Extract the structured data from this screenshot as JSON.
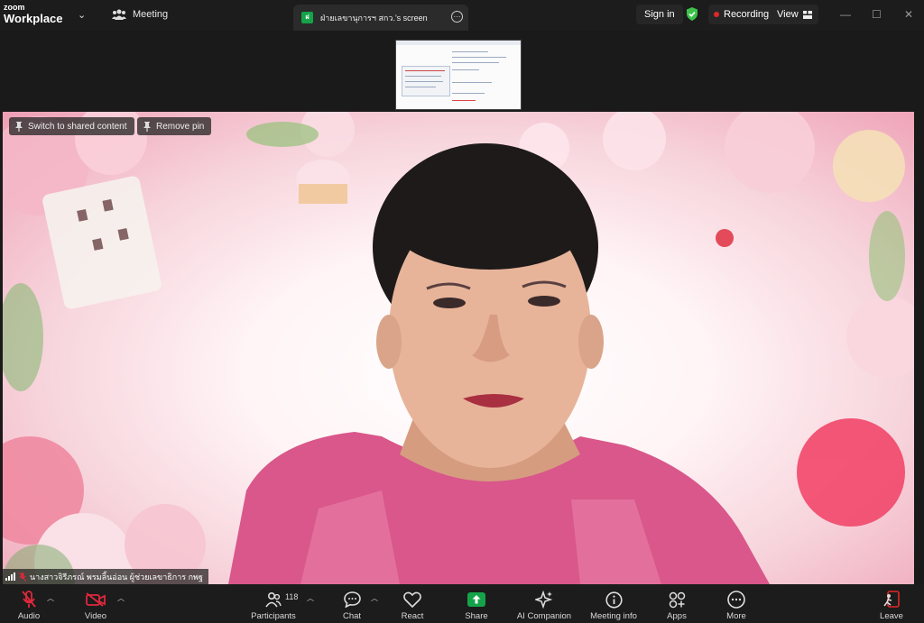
{
  "titlebar": {
    "logo_line1": "zoom",
    "logo_line2": "Workplace",
    "meeting_label": "Meeting",
    "share_tab_badge": "ฝ",
    "share_tab_title": "ฝ่ายเลขานุการฯ สกว.'s screen",
    "sign_in": "Sign in",
    "recording": "Recording",
    "view": "View"
  },
  "video": {
    "switch_label": "Switch to shared content",
    "remove_pin_label": "Remove pin",
    "participant_name": "นางสาวจิรีภรณ์ พรมลิ้นอ่อน ผู้ช่วยเลขาธิการ กพฐ"
  },
  "toolbar": {
    "audio": "Audio",
    "video": "Video",
    "participants": "Participants",
    "participants_count": "118",
    "chat": "Chat",
    "react": "React",
    "share": "Share",
    "ai_companion": "AI Companion",
    "meeting_info": "Meeting info",
    "apps": "Apps",
    "more": "More",
    "leave": "Leave"
  },
  "colors": {
    "share_green": "#15a34a",
    "recording_red": "#e02828",
    "leave_red": "#e02828",
    "muted_red": "#e0283c",
    "shield_green": "#3cc24a"
  }
}
